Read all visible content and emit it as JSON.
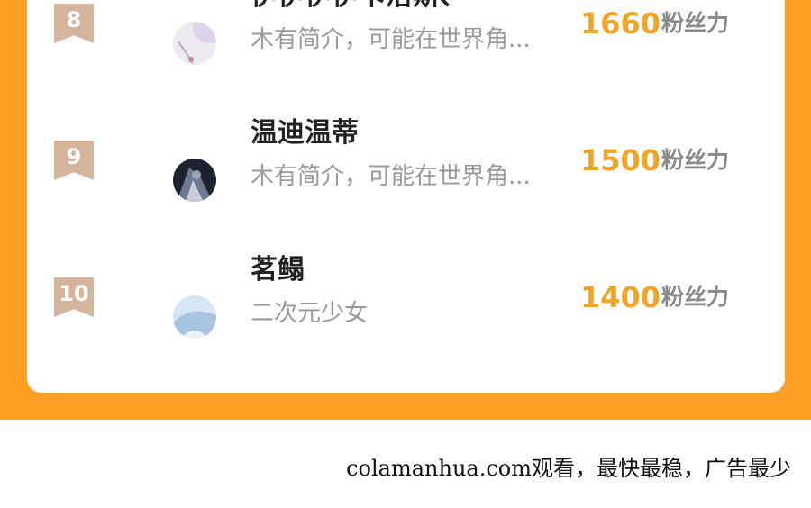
{
  "leaderboard": {
    "entries": [
      {
        "rank": "8",
        "name": "伊伊伊伊卡洛斯、",
        "bio": "木有简介，可能在世界角...",
        "score": "1660",
        "score_unit": "粉丝力",
        "avatar_icon": "user-avatar-light"
      },
      {
        "rank": "9",
        "name": "温迪温蒂",
        "bio": "木有简介，可能在世界角...",
        "score": "1500",
        "score_unit": "粉丝力",
        "avatar_icon": "user-avatar-dark"
      },
      {
        "rank": "10",
        "name": "茗鳎",
        "bio": "二次元少女",
        "score": "1400",
        "score_unit": "粉丝力",
        "avatar_icon": "user-avatar-blue"
      }
    ]
  },
  "footer": {
    "text": "colamanhua.com观看，最快最稳，广告最少"
  },
  "colors": {
    "background_band": "#FF9F23",
    "rank_badge": "#D4B59C",
    "score": "#F0A528",
    "name": "#222222",
    "bio": "#9a9a9a"
  }
}
